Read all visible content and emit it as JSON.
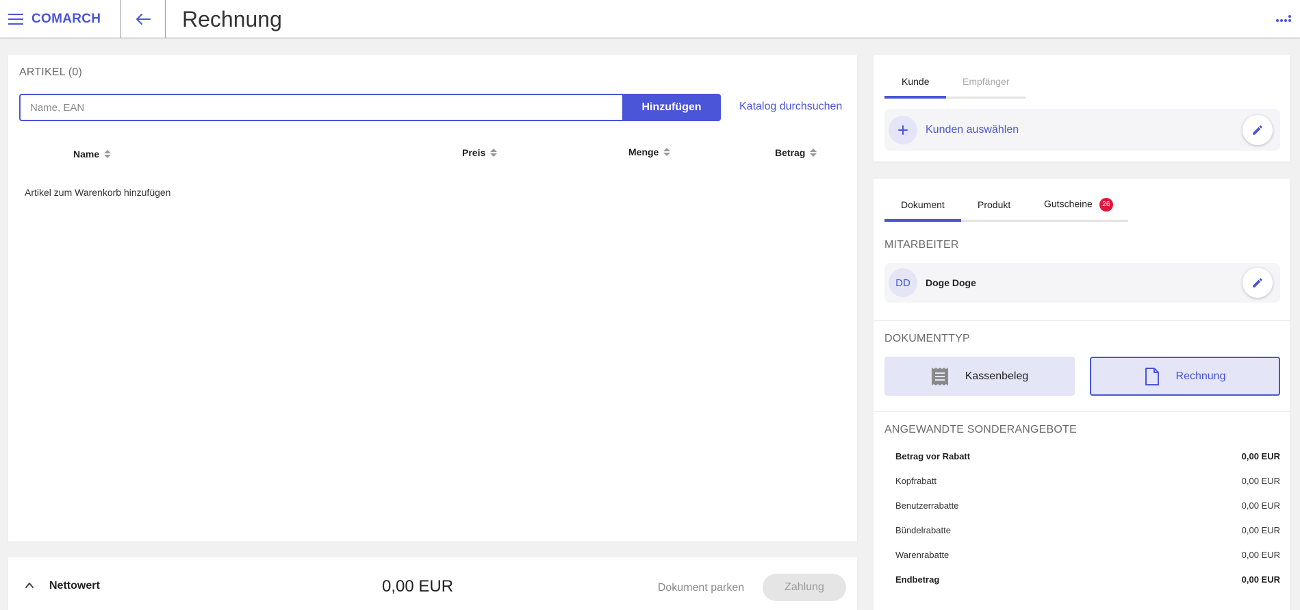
{
  "app": {
    "logo": "COMARCH",
    "title": "Rechnung"
  },
  "articles": {
    "heading": "ARTIKEL (0)",
    "search_placeholder": "Name, EAN",
    "add_label": "Hinzufügen",
    "catalog_label": "Katalog durchsuchen",
    "columns": [
      "Name",
      "Preis",
      "Menge",
      "Betrag"
    ],
    "empty_text": "Artikel zum Warenkorb hinzufügen"
  },
  "footer": {
    "netto_label": "Nettowert",
    "netto_value": "0,00 EUR",
    "park_label": "Dokument parken",
    "pay_label": "Zahlung"
  },
  "customer": {
    "tabs": [
      "Kunde",
      "Empfänger"
    ],
    "select_label": "Kunden auswählen"
  },
  "details": {
    "tabs": [
      "Dokument",
      "Produkt",
      "Gutscheine"
    ],
    "voucher_count": "26",
    "employee_heading": "MITARBEITER",
    "employee_initials": "DD",
    "employee_name": "Doge Doge",
    "doctype_heading": "DOKUMENTTYP",
    "doctypes": [
      "Kassenbeleg",
      "Rechnung"
    ],
    "offers_heading": "ANGEWANDTE SONDERANGEBOTE",
    "summary": [
      {
        "label": "Betrag vor Rabatt",
        "value": "0,00 EUR"
      },
      {
        "label": "Kopfrabatt",
        "value": "0,00 EUR"
      },
      {
        "label": "Benutzerrabatte",
        "value": "0,00 EUR"
      },
      {
        "label": "Bündelrabatte",
        "value": "0,00 EUR"
      },
      {
        "label": "Warenrabatte",
        "value": "0,00 EUR"
      },
      {
        "label": "Endbetrag",
        "value": "0,00 EUR"
      }
    ]
  },
  "colors": {
    "accent": "#4a55d8",
    "badge": "#e0163a",
    "accent_light": "#e4e5f7"
  },
  "icons": [
    "menu-icon",
    "back-arrow-icon",
    "more-icon",
    "plus-icon",
    "pencil-icon",
    "receipt-icon",
    "document-icon",
    "chevron-up-icon",
    "sort-icon"
  ]
}
